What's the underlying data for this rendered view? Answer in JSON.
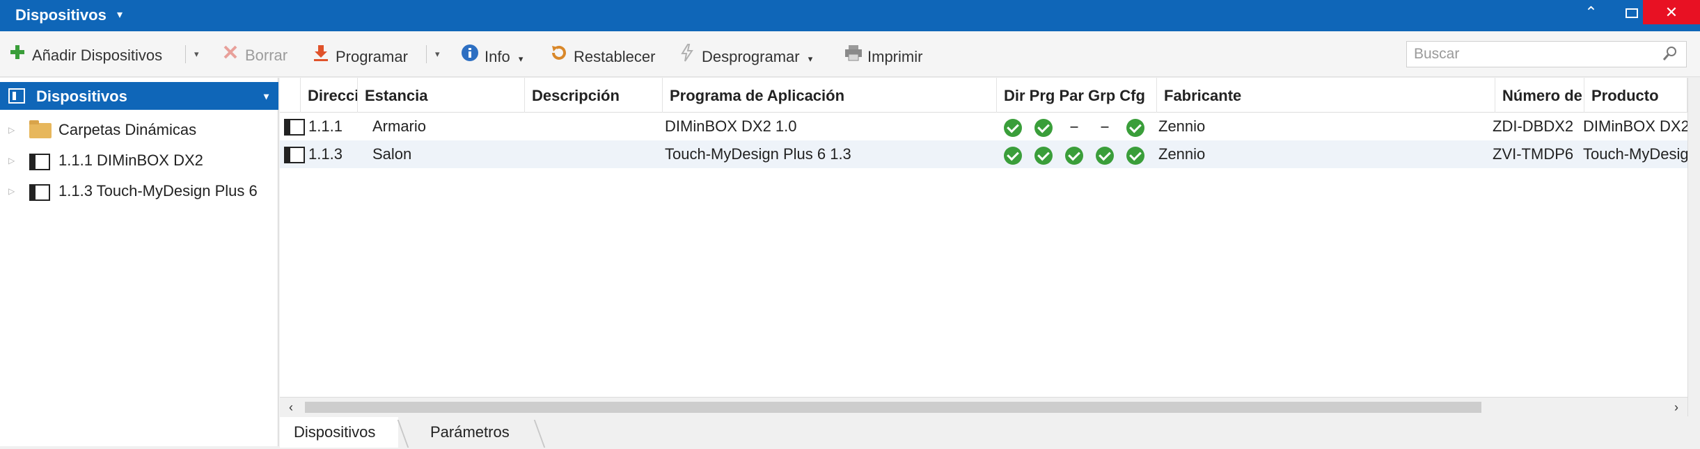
{
  "window": {
    "title": "Dispositivos",
    "title_caret": "▾",
    "btn_up": "⌃",
    "btn_close": "✕"
  },
  "toolbar": {
    "add_label": "Añadir Dispositivos",
    "delete_label": "Borrar",
    "program_label": "Programar",
    "info_label": "Info",
    "reset_label": "Restablecer",
    "unprogram_label": "Desprogramar",
    "print_label": "Imprimir",
    "caret": "▾",
    "search_placeholder": "Buscar",
    "icons": {
      "add": "plus-icon",
      "delete": "x-icon",
      "program": "download-arrow-icon",
      "info": "info-icon",
      "reset": "reset-icon",
      "unprogram": "lightning-icon",
      "print": "printer-icon",
      "search": "search-icon"
    }
  },
  "sidebar": {
    "header": "Dispositivos",
    "header_caret": "▾",
    "expander": "▷",
    "items": [
      {
        "label": "Carpetas Dinámicas",
        "icon": "folder-icon"
      },
      {
        "label": "1.1.1 DIMinBOX DX2",
        "icon": "device-icon"
      },
      {
        "label": "1.1.3 Touch-MyDesign Plus 6",
        "icon": "device-icon"
      }
    ]
  },
  "table": {
    "columns": [
      "Direcci",
      "Estancia",
      "Descripción",
      "Programa de Aplicación",
      "Dir Prg Par Grp Cfg",
      "Fabricante",
      "Número de",
      "Producto"
    ],
    "rows": [
      {
        "address": "1.1.1",
        "room": "Armario",
        "description": "",
        "app_program": "DIMinBOX DX2 1.0",
        "flags": [
          true,
          true,
          "–",
          "–",
          true
        ],
        "manufacturer": "Zennio",
        "order_number": "ZDI-DBDX2",
        "product": "DIMinBOX DX2"
      },
      {
        "address": "1.1.3",
        "room": "Salon",
        "description": "",
        "app_program": "Touch-MyDesign Plus 6 1.3",
        "flags": [
          true,
          true,
          true,
          true,
          true
        ],
        "manufacturer": "Zennio",
        "order_number": "ZVI-TMDP6",
        "product": "Touch-MyDesig"
      }
    ]
  },
  "scrollbar": {
    "left_arrow": "‹",
    "right_arrow": "›"
  },
  "bottom_tabs": [
    {
      "label": "Dispositivos",
      "active": true
    },
    {
      "label": "Parámetros",
      "active": false
    }
  ],
  "colors": {
    "accent": "#0f66b8",
    "close": "#e81123",
    "check": "#3a9e3a",
    "row_alt": "#eef3f9"
  }
}
